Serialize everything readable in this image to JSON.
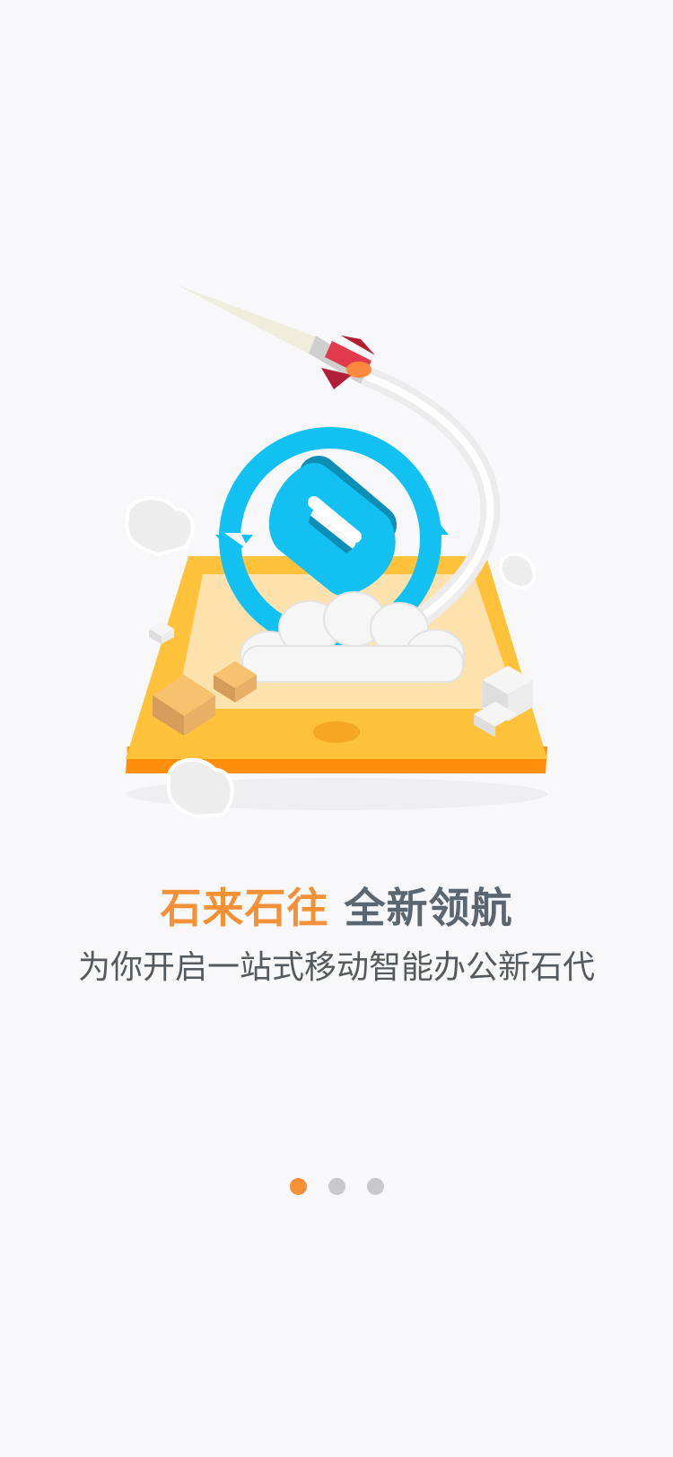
{
  "onboarding": {
    "headline_accent": "石来石往",
    "headline_main": "全新领航",
    "subtitle": "为你开启一站式移动智能办公新石代",
    "pages": [
      {
        "active": true
      },
      {
        "active": false
      },
      {
        "active": false
      }
    ],
    "illustration_icons": [
      "rocket-icon",
      "sync-logo-icon",
      "tablet-icon",
      "cloud-icon",
      "box-icon"
    ]
  },
  "colors": {
    "accent": "#f39137",
    "headline_dark": "#5b6670",
    "logo_blue": "#12c1f1",
    "tablet_orange": "#ffc53d",
    "dot_inactive": "#c9c9cc",
    "background": "#f8f7f9"
  }
}
